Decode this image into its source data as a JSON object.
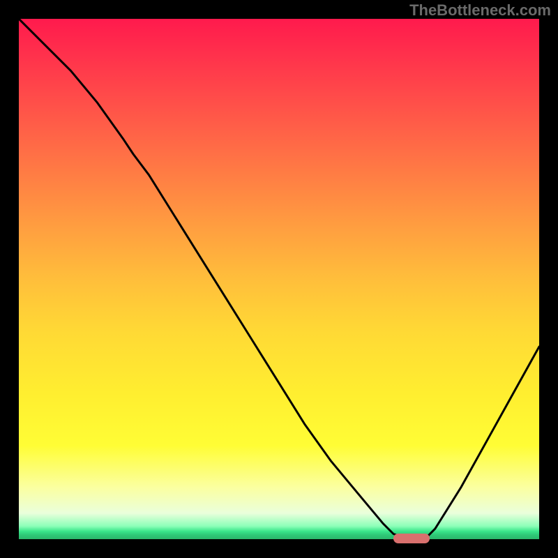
{
  "watermark": "TheBottleneck.com",
  "colors": {
    "background": "#000000",
    "marker": "#d9706e",
    "curve": "#000000"
  },
  "chart_data": {
    "type": "line",
    "title": "",
    "xlabel": "",
    "ylabel": "",
    "xlim": [
      0,
      100
    ],
    "ylim": [
      0,
      100
    ],
    "background_gradient": {
      "orientation": "vertical",
      "meaning": "bottleneck severity (red=100% high, green=0% low)",
      "stops": [
        {
          "pos": 0,
          "color": "#ff1a4d"
        },
        {
          "pos": 50,
          "color": "#ffbe3b"
        },
        {
          "pos": 82,
          "color": "#fffd35"
        },
        {
          "pos": 100,
          "color": "#2bb66a"
        }
      ]
    },
    "series": [
      {
        "name": "bottleneck-curve",
        "x": [
          0,
          5,
          10,
          15,
          20,
          22,
          25,
          30,
          35,
          40,
          45,
          50,
          55,
          60,
          65,
          70,
          72,
          75,
          78,
          80,
          85,
          90,
          95,
          100
        ],
        "y": [
          100,
          95,
          90,
          84,
          77,
          74,
          70,
          62,
          54,
          46,
          38,
          30,
          22,
          15,
          9,
          3,
          1,
          0,
          0,
          2,
          10,
          19,
          28,
          37
        ]
      }
    ],
    "minimum_region": {
      "x_start": 72,
      "x_end": 79,
      "y": 0
    },
    "annotations": []
  }
}
